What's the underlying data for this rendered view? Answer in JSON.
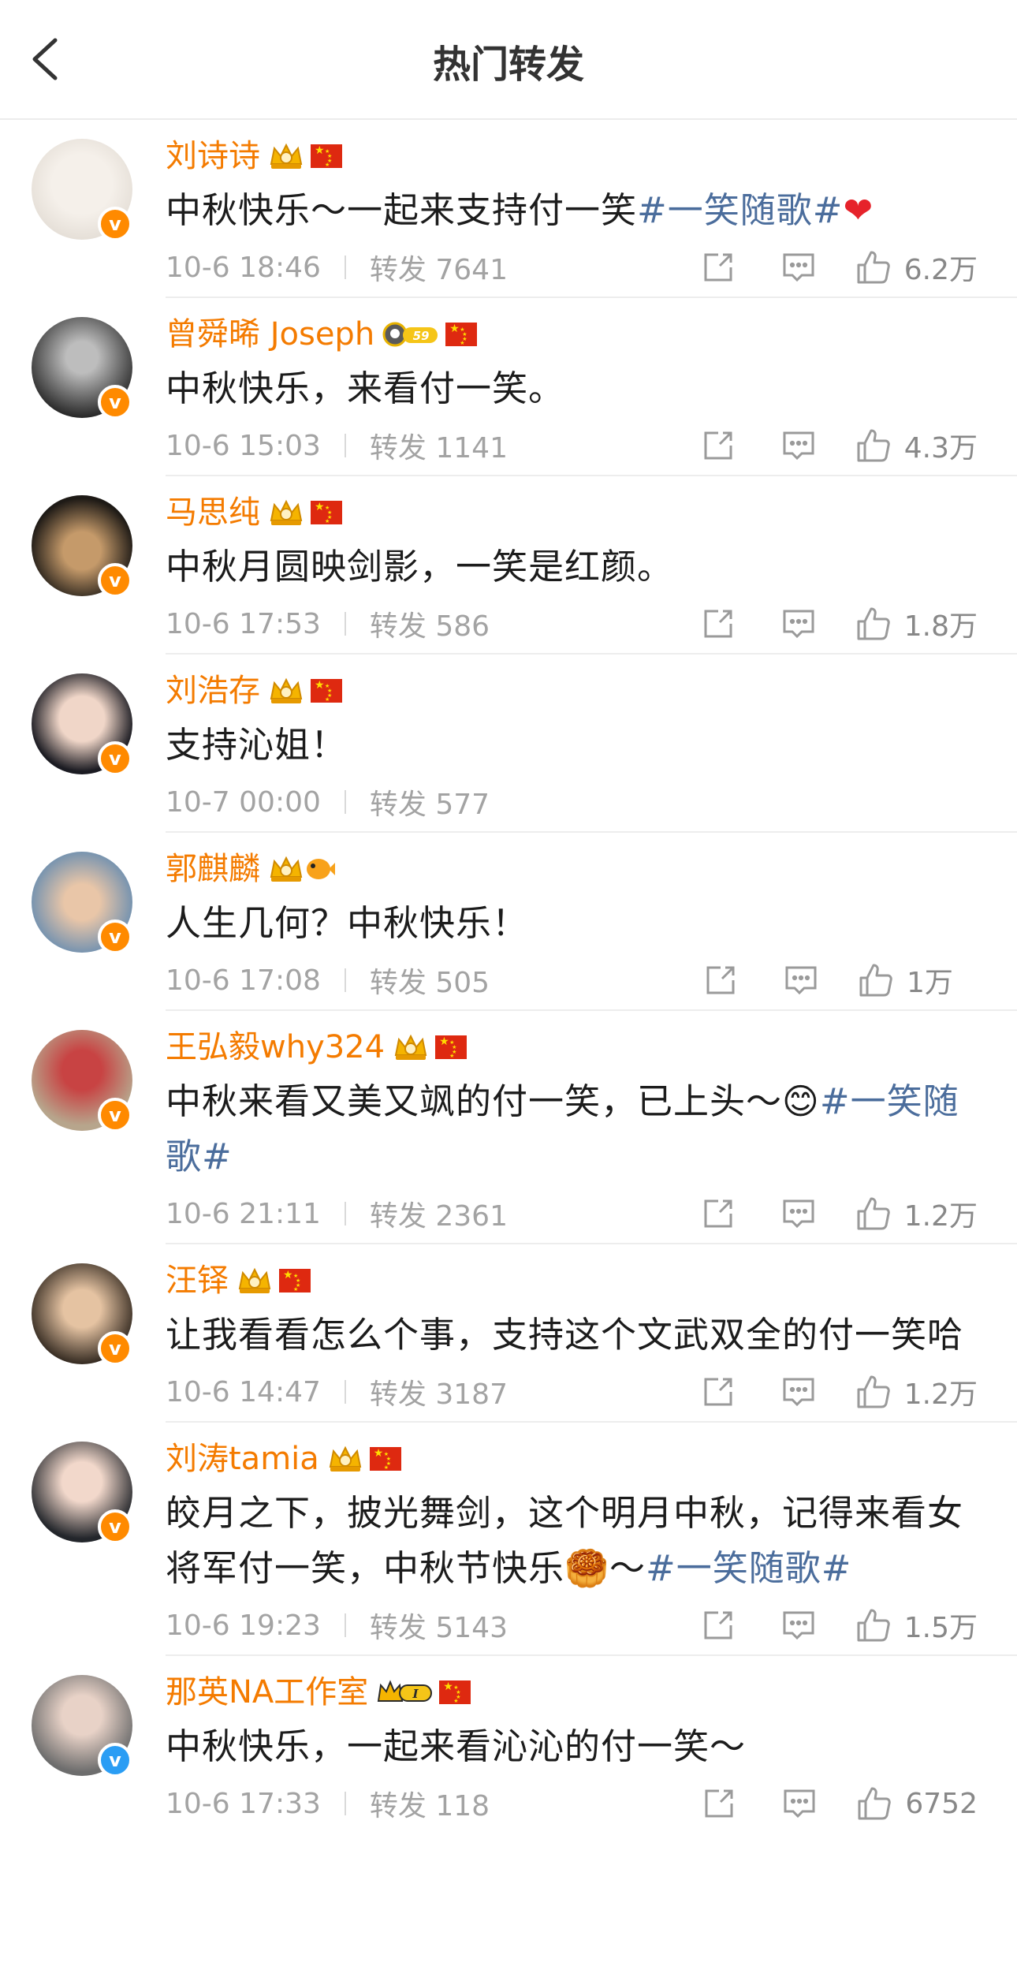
{
  "header": {
    "title": "热门转发"
  },
  "reposts": [
    {
      "name": "刘诗诗",
      "vip_badge": "crown",
      "flag": true,
      "verified": "orange",
      "text": "中秋快乐～一起来支持付一笑",
      "tag": "#一笑随歌#",
      "text_after": "",
      "emoji": "❤️",
      "time": "10-6 18:46",
      "repost_label": "转发",
      "repost_count": "7641",
      "likes": "6.2万",
      "show_actions": true
    },
    {
      "name": "曾舜晞 Joseph",
      "vip_badge": "astronaut-59",
      "flag": true,
      "verified": "orange",
      "text": "中秋快乐，来看付一笑。",
      "tag": "",
      "text_after": "",
      "emoji": "",
      "time": "10-6 15:03",
      "repost_label": "转发",
      "repost_count": "1141",
      "likes": "4.3万",
      "show_actions": true
    },
    {
      "name": "马思纯",
      "vip_badge": "crown",
      "flag": true,
      "verified": "orange",
      "text": "中秋月圆映剑影，一笑是红颜。",
      "tag": "",
      "text_after": "",
      "emoji": "",
      "time": "10-6 17:53",
      "repost_label": "转发",
      "repost_count": "586",
      "likes": "1.8万",
      "show_actions": true
    },
    {
      "name": "刘浩存",
      "vip_badge": "crown",
      "flag": true,
      "verified": "orange",
      "text": "支持沁姐！",
      "tag": "",
      "text_after": "",
      "emoji": "",
      "time": "10-7 00:00",
      "repost_label": "转发",
      "repost_count": "577",
      "likes": "",
      "show_actions": false
    },
    {
      "name": "郭麒麟",
      "vip_badge": "crown",
      "flag": false,
      "verified": "orange",
      "text": "人生几何？中秋快乐！",
      "tag": "",
      "text_after": "",
      "emoji": "",
      "time": "10-6 17:08",
      "repost_label": "转发",
      "repost_count": "505",
      "likes": "1万",
      "show_actions": true
    },
    {
      "name": "王弘毅why324",
      "vip_badge": "crown",
      "flag": true,
      "verified": "orange",
      "text": "中秋来看又美又飒的付一笑，已上头～😊",
      "tag": "#一笑随歌#",
      "text_after": "",
      "emoji": "",
      "time": "10-6 21:11",
      "repost_label": "转发",
      "repost_count": "2361",
      "likes": "1.2万",
      "show_actions": true
    },
    {
      "name": "汪铎",
      "vip_badge": "crown",
      "flag": true,
      "verified": "orange",
      "text": "让我看看怎么个事，支持这个文武双全的付一笑哈",
      "tag": "",
      "text_after": "",
      "emoji": "",
      "time": "10-6 14:47",
      "repost_label": "转发",
      "repost_count": "3187",
      "likes": "1.2万",
      "show_actions": true
    },
    {
      "name": "刘涛tamia",
      "vip_badge": "crown",
      "flag": true,
      "verified": "orange",
      "text": "皎月之下，披光舞剑，这个明月中秋，记得来看女将军付一笑，中秋节快乐🥮～",
      "tag": "#一笑随歌#",
      "text_after": "",
      "emoji": "",
      "time": "10-6 19:23",
      "repost_label": "转发",
      "repost_count": "5143",
      "likes": "1.5万",
      "show_actions": true
    },
    {
      "name": "那英NA工作室",
      "vip_badge": "level-I",
      "flag": true,
      "verified": "blue",
      "text": "中秋快乐，一起来看沁沁的付一笑～",
      "tag": "",
      "text_after": "",
      "emoji": "",
      "time": "10-6 17:33",
      "repost_label": "转发",
      "repost_count": "118",
      "likes": "6752",
      "show_actions": true
    }
  ],
  "colors": {
    "name": "#f47b00",
    "tag": "#4b6d9c",
    "meta": "#a3a3a3",
    "verified_orange": "#ff8a00",
    "verified_blue": "#2a9df4"
  }
}
